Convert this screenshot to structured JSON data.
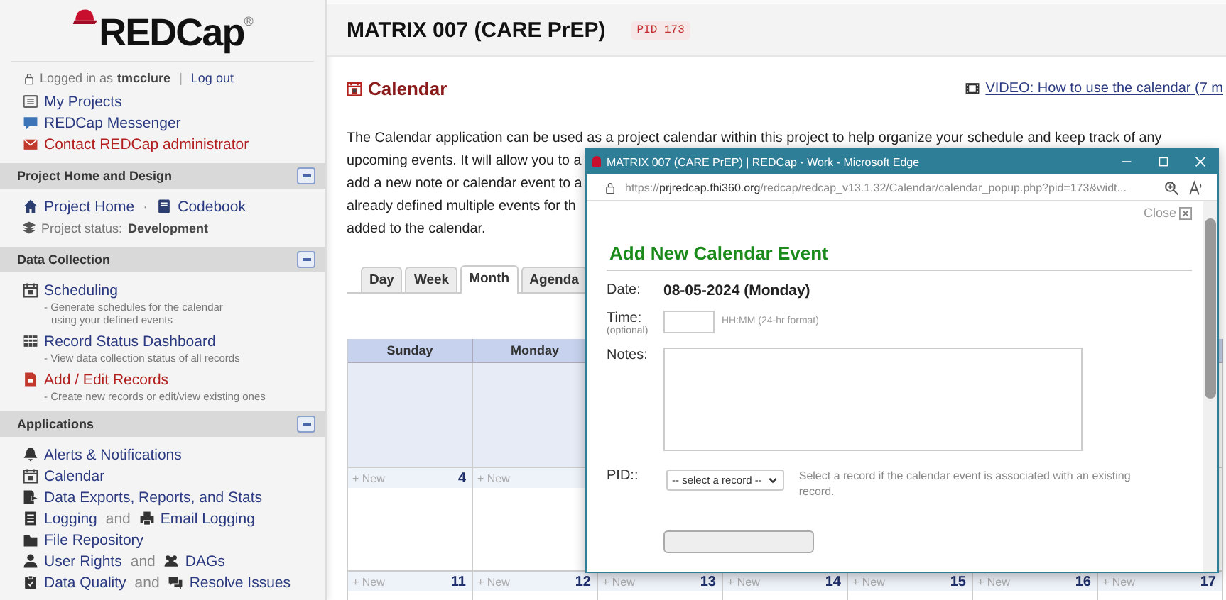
{
  "sidebar": {
    "logo": "REDCap",
    "logo_mark": "®",
    "user": {
      "prefix": "Logged in as",
      "username": "tmcclure",
      "separator": "|",
      "logout": "Log out"
    },
    "links": [
      {
        "label": "My Projects",
        "kind": "link"
      },
      {
        "label": "REDCap Messenger",
        "kind": "link"
      },
      {
        "label": "Contact REDCap administrator",
        "kind": "alert"
      }
    ],
    "sections": [
      {
        "title": "Project Home and Design",
        "expanded": true,
        "items": [
          {
            "kind": "pair",
            "links": [
              "Project Home",
              "Codebook"
            ],
            "joiner": "·"
          },
          {
            "kind": "status",
            "label": "Project status:",
            "value": "Development"
          }
        ]
      },
      {
        "title": "Data Collection",
        "expanded": true,
        "items": [
          {
            "kind": "link",
            "label": "Scheduling",
            "description": [
              "- Generate schedules for the calendar",
              "using your defined events"
            ]
          },
          {
            "kind": "link",
            "label": "Record Status Dashboard",
            "description": [
              "- View data collection status of all records"
            ]
          },
          {
            "kind": "alert",
            "label": "Add / Edit Records",
            "description": [
              "- Create new records or edit/view existing ones"
            ]
          }
        ]
      },
      {
        "title": "Applications",
        "expanded": true,
        "items": [
          {
            "kind": "link",
            "label": "Alerts & Notifications"
          },
          {
            "kind": "link",
            "label": "Calendar"
          },
          {
            "kind": "link",
            "label": "Data Exports, Reports, and Stats"
          },
          {
            "kind": "pair",
            "links": [
              "Logging",
              "Email Logging"
            ],
            "joiner": "and"
          },
          {
            "kind": "link",
            "label": "File Repository"
          },
          {
            "kind": "pair",
            "links": [
              "User Rights",
              "DAGs"
            ],
            "joiner": "and"
          },
          {
            "kind": "pair",
            "links": [
              "Data Quality",
              "Resolve Issues"
            ],
            "joiner": "and"
          }
        ]
      }
    ]
  },
  "header": {
    "title": "MATRIX 007 (CARE PrEP)",
    "badge": "PID 173"
  },
  "page": {
    "title": "Calendar",
    "video_link": "VIDEO: How to use the calendar (7 m",
    "intro_lines": [
      "The Calendar application can be used as a project calendar within this project to help organize your schedule and keep track of any",
      "upcoming events. It will allow you to a",
      "add a new note or calendar event to a",
      "already defined multiple events for th",
      "added to the calendar."
    ]
  },
  "calendar": {
    "tabs": [
      {
        "label": "Day",
        "selected": false
      },
      {
        "label": "Week",
        "selected": false
      },
      {
        "label": "Month",
        "selected": true
      },
      {
        "label": "Agenda",
        "selected": false
      }
    ],
    "weekdays": [
      "Sunday",
      "Monday"
    ],
    "weeks": [
      {
        "cells": [
          {
            "kind": "outside"
          },
          {
            "kind": "outside"
          }
        ]
      },
      {
        "cells": [
          {
            "kind": "day",
            "new_label": "+ New",
            "number": "4"
          },
          {
            "kind": "day",
            "new_label": "+ New"
          }
        ]
      },
      {
        "cells": [
          {
            "kind": "day",
            "new_label": "+ New",
            "number": "11"
          },
          {
            "kind": "day",
            "new_label": "+ New",
            "number": "12"
          },
          {
            "kind": "day",
            "new_label": "+ New",
            "number": "13"
          },
          {
            "kind": "day",
            "new_label": "+ New",
            "number": "14"
          },
          {
            "kind": "day",
            "new_label": "+ New",
            "number": "15"
          },
          {
            "kind": "day",
            "new_label": "+ New",
            "number": "16"
          },
          {
            "kind": "day",
            "new_label": "+ New",
            "number": "17"
          }
        ]
      }
    ]
  },
  "popup": {
    "title": "MATRIX 007 (CARE PrEP) | REDCap - Work - Microsoft Edge",
    "url": {
      "scheme": "https://",
      "host": "prjredcap.fhi360.org",
      "path": "/redcap/redcap_v13.1.32/Calendar/calendar_popup.php?pid=173&widt..."
    },
    "close_label": "Close",
    "heading": "Add New Calendar Event",
    "date_label": "Date:",
    "date_value": "08-05-2024 (Monday)",
    "time_label": "Time:",
    "time_note": "(optional)",
    "time_hint": "HH:MM (24-hr format)",
    "notes_label": "Notes:",
    "record_label": "PID::",
    "record_select": "-- select a record --",
    "record_help": "Select a record if the calendar event is associated with an existing record."
  }
}
